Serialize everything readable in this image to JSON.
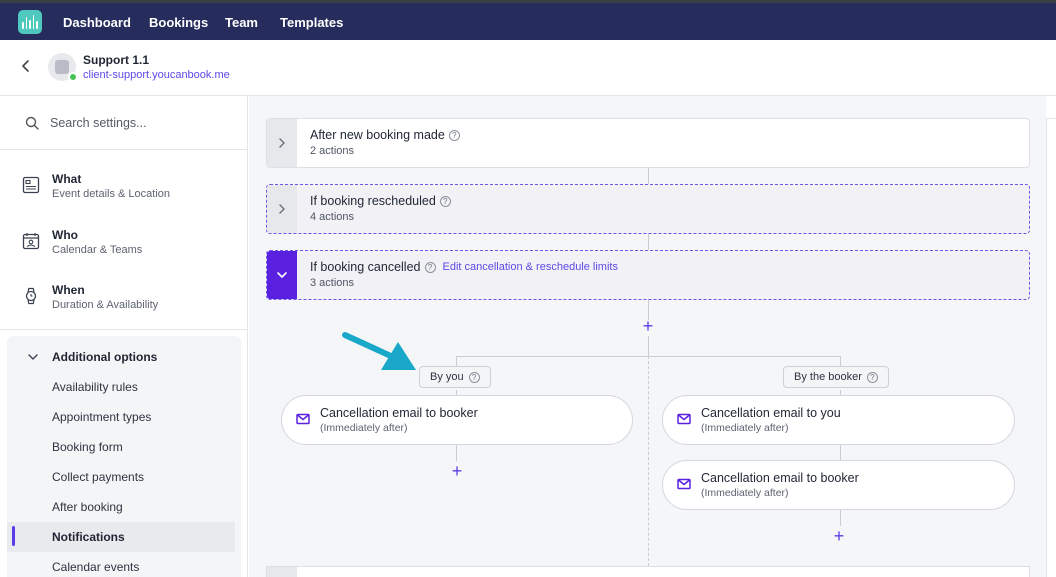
{
  "nav": {
    "items": [
      "Dashboard",
      "Bookings",
      "Team",
      "Templates"
    ],
    "logo_icon": "youcanbook-logo-icon"
  },
  "page": {
    "name": "Support 1.1",
    "url": "client-support.youcanbook.me",
    "status_color": "#46c356"
  },
  "sidebar": {
    "search_placeholder": "Search settings...",
    "sections": [
      {
        "title": "What",
        "subtitle": "Event details & Location",
        "icon": "document-icon"
      },
      {
        "title": "Who",
        "subtitle": "Calendar & Teams",
        "icon": "calendar-person-icon"
      },
      {
        "title": "When",
        "subtitle": "Duration & Availability",
        "icon": "watch-icon"
      }
    ],
    "additional": {
      "title": "Additional options",
      "items": [
        "Availability rules",
        "Appointment types",
        "Booking form",
        "Collect payments",
        "After booking",
        "Notifications",
        "Calendar events"
      ],
      "active": "Notifications"
    }
  },
  "workflow": {
    "triggers": [
      {
        "title": "After new booking made",
        "subtitle": "2 actions",
        "state": "collapsed"
      },
      {
        "title": "If booking rescheduled",
        "subtitle": "4 actions",
        "state": "collapsed"
      },
      {
        "title": "If booking cancelled",
        "subtitle": "3 actions",
        "state": "expanded",
        "link": "Edit cancellation & reschedule limits"
      }
    ],
    "branches": [
      {
        "label": "By you",
        "actions": [
          {
            "title": "Cancellation email to booker",
            "timing": "(Immediately after)"
          }
        ]
      },
      {
        "label": "By the booker",
        "actions": [
          {
            "title": "Cancellation email to you",
            "timing": "(Immediately after)"
          },
          {
            "title": "Cancellation email to booker",
            "timing": "(Immediately after)"
          }
        ]
      }
    ],
    "accent_color": "#5b21e0",
    "annotation_arrow_color": "#1aa8c9"
  }
}
